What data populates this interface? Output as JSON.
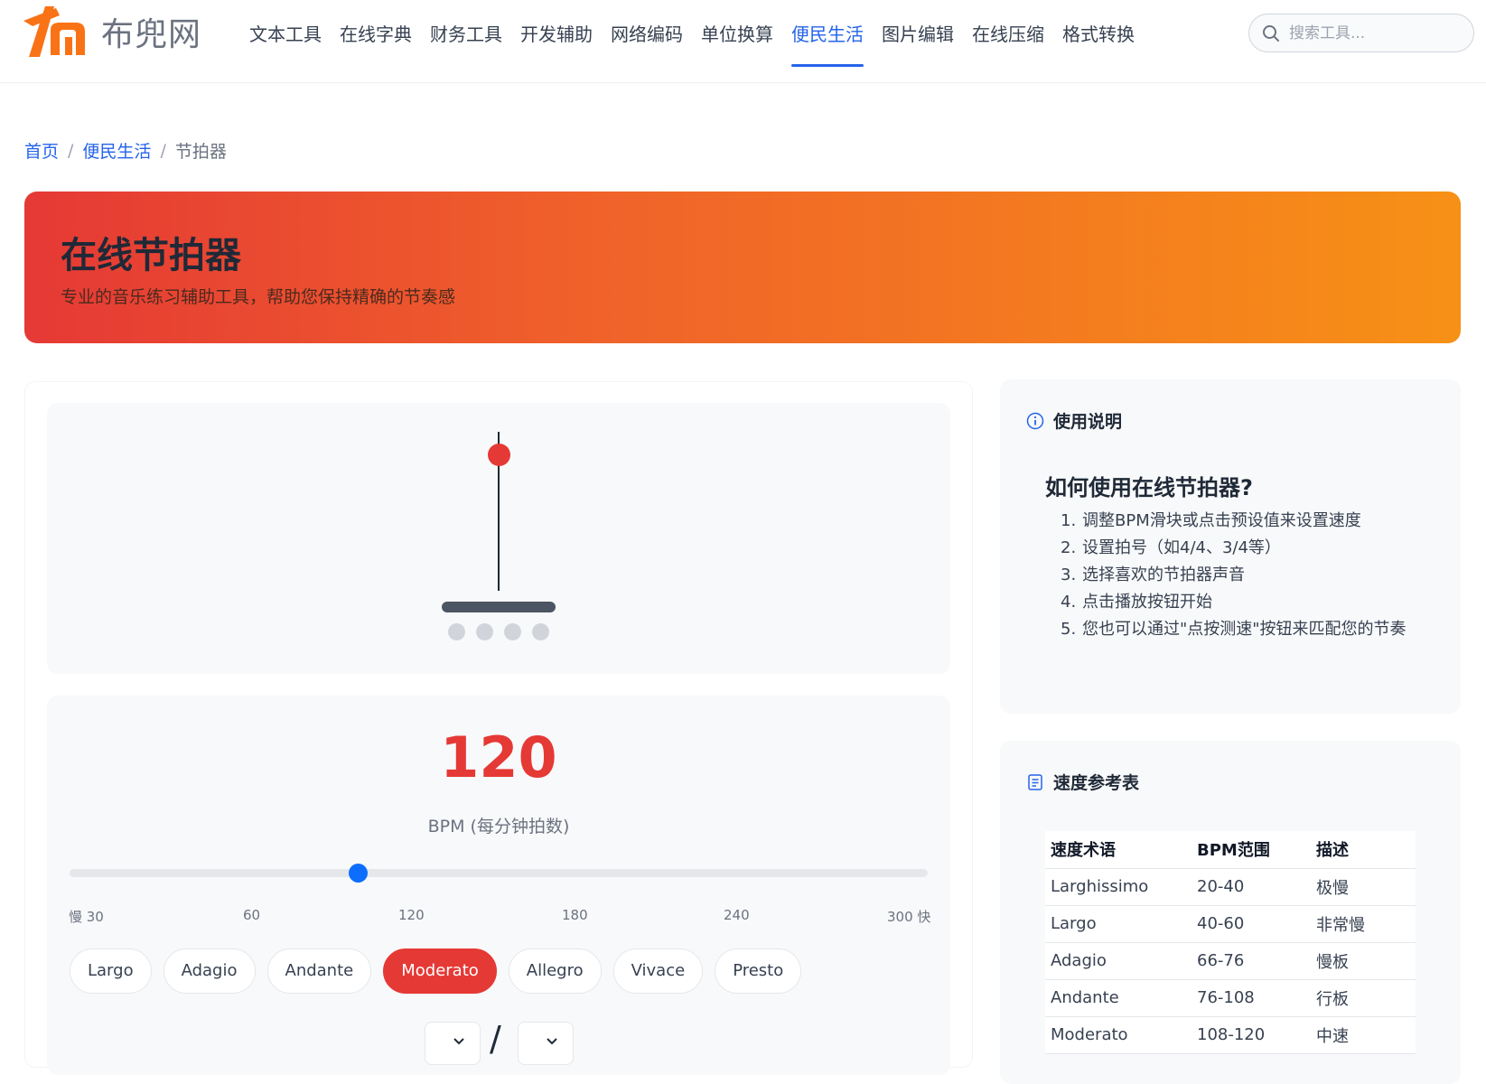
{
  "header": {
    "logo_text": "布兜网",
    "nav": [
      {
        "label": "文本工具",
        "active": false
      },
      {
        "label": "在线字典",
        "active": false
      },
      {
        "label": "财务工具",
        "active": false
      },
      {
        "label": "开发辅助",
        "active": false
      },
      {
        "label": "网络编码",
        "active": false
      },
      {
        "label": "单位换算",
        "active": false
      },
      {
        "label": "便民生活",
        "active": true
      },
      {
        "label": "图片编辑",
        "active": false
      },
      {
        "label": "在线压缩",
        "active": false
      },
      {
        "label": "格式转换",
        "active": false
      }
    ],
    "search_placeholder": "搜索工具..."
  },
  "breadcrumb": {
    "home": "首页",
    "category": "便民生活",
    "current": "节拍器",
    "separator": "/"
  },
  "hero": {
    "title": "在线节拍器",
    "subtitle": "专业的音乐练习辅助工具，帮助您保持精确的节奏感"
  },
  "metronome": {
    "bpm": "120",
    "bpm_label": "BPM (每分钟拍数)",
    "slider_min": 30,
    "slider_max": 300,
    "slider_value": 120,
    "tick_labels": [
      "慢 30",
      "60",
      "120",
      "180",
      "240",
      "300 快"
    ],
    "beat_count": 4,
    "presets": [
      {
        "label": "Largo",
        "active": false
      },
      {
        "label": "Adagio",
        "active": false
      },
      {
        "label": "Andante",
        "active": false
      },
      {
        "label": "Moderato",
        "active": true
      },
      {
        "label": "Allegro",
        "active": false
      },
      {
        "label": "Vivace",
        "active": false
      },
      {
        "label": "Presto",
        "active": false
      }
    ],
    "time_sig_separator": "/"
  },
  "instructions": {
    "heading": "使用说明",
    "title": "如何使用在线节拍器?",
    "steps": [
      {
        "num": "1.",
        "text": "调整BPM滑块或点击预设值来设置速度"
      },
      {
        "num": "2.",
        "text": "设置拍号（如4/4、3/4等）"
      },
      {
        "num": "3.",
        "text": "选择喜欢的节拍器声音"
      },
      {
        "num": "4.",
        "text": "点击播放按钮开始"
      },
      {
        "num": "5.",
        "text": "您也可以通过\"点按测速\"按钮来匹配您的节奏"
      }
    ]
  },
  "tempo_ref": {
    "heading": "速度参考表",
    "columns": [
      "速度术语",
      "BPM范围",
      "描述"
    ],
    "rows": [
      [
        "Larghissimo",
        "20-40",
        "极慢"
      ],
      [
        "Largo",
        "40-60",
        "非常慢"
      ],
      [
        "Adagio",
        "66-76",
        "慢板"
      ],
      [
        "Andante",
        "76-108",
        "行板"
      ],
      [
        "Moderato",
        "108-120",
        "中速"
      ]
    ]
  },
  "colors": {
    "accent_red": "#e53935",
    "link_blue": "#2563eb",
    "slider_blue": "#0d6efd"
  }
}
